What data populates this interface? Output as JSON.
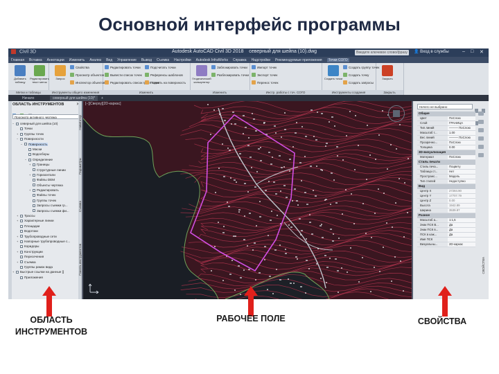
{
  "slide": {
    "title": "Основной интерфейс программы"
  },
  "window": {
    "quick_access": "Civil 3D",
    "app_title": "Autodesk AutoCAD Civil 3D 2018",
    "file_title": "северный для шейпа (10).dwg",
    "search_placeholder": "Введите ключевое слово/фразу",
    "user_label": "Вход в службы",
    "minimize": "–",
    "maximize": "□",
    "close": "✕"
  },
  "ribbon_tabs": [
    {
      "label": "Главная",
      "active": false
    },
    {
      "label": "Вставка",
      "active": false
    },
    {
      "label": "Аннотации",
      "active": false
    },
    {
      "label": "Изменить",
      "active": false
    },
    {
      "label": "Анализ",
      "active": false
    },
    {
      "label": "Вид",
      "active": false
    },
    {
      "label": "Управление",
      "active": false
    },
    {
      "label": "Вывод",
      "active": false
    },
    {
      "label": "Съемка",
      "active": false
    },
    {
      "label": "Настройки",
      "active": false
    },
    {
      "label": "Autodesk InfraWorks",
      "active": false
    },
    {
      "label": "Справка",
      "active": false
    },
    {
      "label": "Надстройки",
      "active": false
    },
    {
      "label": "Рекомендуемые приложения",
      "active": false
    },
    {
      "label": "Точки СОГО",
      "active": true
    }
  ],
  "ribbon_groups": [
    {
      "label": "Метки и таблицы",
      "big": [
        {
          "label": "Добавить таблицу",
          "color": "#4a7fc1"
        },
        {
          "label": "Редактировать текст меток",
          "color": "#6aa84f"
        }
      ]
    },
    {
      "label": "Инструменты общего изменения",
      "big": [
        {
          "label": "Запрос",
          "color": "#e6a23c"
        }
      ],
      "small": [
        "Свойства",
        "Просмотр объектов",
        "Инспектор объектов"
      ]
    },
    {
      "label": "Изменить",
      "big": [],
      "small": [
        "Редактировать точки",
        "Вывести список точек",
        "Редактировать список групп точек",
        "Подсчитать точки",
        "Референсы шаблонов",
        "Поднять на поверхность"
      ]
    },
    {
      "label": "Изменить",
      "big": [
        {
          "label": "Геодезический калькулятор",
          "color": "#8e7cc3"
        }
      ],
      "small": [
        "Заблокировать точки",
        "Разблокировать точки"
      ]
    },
    {
      "label": "Инстр. работы с точ. СОГО",
      "big": [],
      "small": [
        "Импорт точек",
        "Экспорт точек",
        "Перенос точек"
      ]
    },
    {
      "label": "Инструменты создания",
      "big": [
        {
          "label": "Создать точки",
          "color": "#3d85c6"
        }
      ],
      "small": [
        "Создать группу точек",
        "Создать точку",
        "Создать запросы"
      ]
    },
    {
      "label": "Закрыть",
      "big": [
        {
          "label": "Закрыть",
          "color": "#cc4125"
        }
      ]
    }
  ],
  "doc_tabs": [
    {
      "label": "Начало",
      "active": false
    },
    {
      "label": "северный для шейпа (10)*",
      "active": true
    },
    {
      "label": "+",
      "active": false
    }
  ],
  "toolspace": {
    "header": "ОБЛАСТЬ ИНСТРУМЕНТОВ",
    "close": "✕",
    "view_dropdown": "Просмотр активного чертежа",
    "tree": [
      {
        "label": "северный для шейпа (10)",
        "level": 0,
        "toggle": "−",
        "selected": false
      },
      {
        "label": "Точки",
        "level": 1,
        "toggle": "",
        "selected": false
      },
      {
        "label": "Группы точек",
        "level": 1,
        "toggle": "+",
        "selected": false
      },
      {
        "label": "Поверхности",
        "level": 1,
        "toggle": "−",
        "selected": false
      },
      {
        "label": "Поверхность",
        "level": 2,
        "toggle": "−",
        "selected": true
      },
      {
        "label": "Маски",
        "level": 3,
        "toggle": "",
        "selected": false
      },
      {
        "label": "Водосборы",
        "level": 3,
        "toggle": "",
        "selected": false
      },
      {
        "label": "Определение",
        "level": 3,
        "toggle": "−",
        "selected": false
      },
      {
        "label": "Границы",
        "level": 4,
        "toggle": "+",
        "selected": false
      },
      {
        "label": "Структурные линии",
        "level": 4,
        "toggle": "",
        "selected": false
      },
      {
        "label": "Горизонтали",
        "level": 4,
        "toggle": "+",
        "selected": false
      },
      {
        "label": "Файлы DEM",
        "level": 4,
        "toggle": "",
        "selected": false
      },
      {
        "label": "Объекты чертежа",
        "level": 4,
        "toggle": "",
        "selected": false
      },
      {
        "label": "Редактировать",
        "level": 4,
        "toggle": "+",
        "selected": false
      },
      {
        "label": "Файлы точек",
        "level": 4,
        "toggle": "",
        "selected": false
      },
      {
        "label": "Группы точек",
        "level": 4,
        "toggle": "",
        "selected": false
      },
      {
        "label": "Запросы съемки гр...",
        "level": 4,
        "toggle": "",
        "selected": false
      },
      {
        "label": "Запросы съемки фи...",
        "level": 4,
        "toggle": "",
        "selected": false
      },
      {
        "label": "Трассы",
        "level": 1,
        "toggle": "+",
        "selected": false
      },
      {
        "label": "Характерные линии",
        "level": 1,
        "toggle": "+",
        "selected": false
      },
      {
        "label": "Площадки",
        "level": 1,
        "toggle": "",
        "selected": false
      },
      {
        "label": "Водотоки",
        "level": 1,
        "toggle": "",
        "selected": false
      },
      {
        "label": "Трубопроводные сети",
        "level": 1,
        "toggle": "+",
        "selected": false
      },
      {
        "label": "Напорные трубопроводные с...",
        "level": 1,
        "toggle": "+",
        "selected": false
      },
      {
        "label": "Коридоры",
        "level": 1,
        "toggle": "",
        "selected": false
      },
      {
        "label": "Конструкции",
        "level": 1,
        "toggle": "+",
        "selected": false
      },
      {
        "label": "Пересечения",
        "level": 1,
        "toggle": "",
        "selected": false
      },
      {
        "label": "Съемка",
        "level": 1,
        "toggle": "+",
        "selected": false
      },
      {
        "label": "Группы рамок вида",
        "level": 1,
        "toggle": "",
        "selected": false
      },
      {
        "label": "Быстрые ссылки на данные []",
        "level": 0,
        "toggle": "+",
        "selected": false
      },
      {
        "label": "Приложения",
        "level": 1,
        "toggle": "",
        "selected": false
      }
    ],
    "side_tabs": [
      "Навигатор",
      "Параметры",
      "Съемка",
      "Панель инструментов"
    ]
  },
  "canvas": {
    "viewport_label": "[−][Сверху][2D-каркас]",
    "background": "#1d2027"
  },
  "properties": {
    "selection": "Ничего не выбрано",
    "sections": [
      {
        "name": "Общие",
        "rows": [
          {
            "key": "Цвет",
            "value": "ПоСлою"
          },
          {
            "key": "Слой",
            "value": "ГРАНИЦА"
          },
          {
            "key": "Тип линий",
            "value": "——— ПоСлою"
          },
          {
            "key": "Масштаб т...",
            "value": "1.00"
          },
          {
            "key": "Вес линий",
            "value": "——— ПоСлою"
          },
          {
            "key": "Прозрачно...",
            "value": "ПоСлою"
          },
          {
            "key": "Толщина",
            "value": "0.00"
          }
        ]
      },
      {
        "name": "3D-визуализация",
        "rows": [
          {
            "key": "Материал",
            "value": "ПоСлою"
          }
        ]
      },
      {
        "name": "Стиль печати",
        "rows": [
          {
            "key": "Стиль печа...",
            "value": "Поцвету"
          },
          {
            "key": "Таблица ст...",
            "value": "Нет"
          },
          {
            "key": "Пространс...",
            "value": "Модель"
          },
          {
            "key": "Тип стилей",
            "value": "Недоступно"
          }
        ]
      },
      {
        "name": "Вид",
        "rows": [
          {
            "key": "Центр X",
            "value": "27284.90"
          },
          {
            "key": "Центр Y",
            "value": "17707.79"
          },
          {
            "key": "Центр Z",
            "value": "0.00"
          },
          {
            "key": "Высота",
            "value": "1942.89"
          },
          {
            "key": "Ширина",
            "value": "3539.87"
          }
        ]
      },
      {
        "name": "Разное",
        "rows": [
          {
            "key": "Масштаб а...",
            "value": "1:1,5"
          },
          {
            "key": "Знак ПСК В...",
            "value": "Да"
          },
          {
            "key": "Знак ПСК в...",
            "value": "Да"
          },
          {
            "key": "ПСК в каж...",
            "value": "Да"
          },
          {
            "key": "Имя ПСК",
            "value": ""
          },
          {
            "key": "Визуальны...",
            "value": "2D-каркас"
          }
        ]
      }
    ],
    "side_label": "СВОЙСТВА"
  },
  "annotations": [
    {
      "id": "tools",
      "lines": [
        "ОБЛАСТЬ",
        "ИНСТРУМЕНТОВ"
      ]
    },
    {
      "id": "work",
      "lines": [
        "РАБОЧЕЕ ПОЛЕ"
      ]
    },
    {
      "id": "props",
      "lines": [
        "СВОЙСТВА"
      ]
    }
  ],
  "colors": {
    "arrow": "#e0201b",
    "boundary": "#d24fe3",
    "contours": "#a8324a",
    "water": "#1a1e25"
  }
}
